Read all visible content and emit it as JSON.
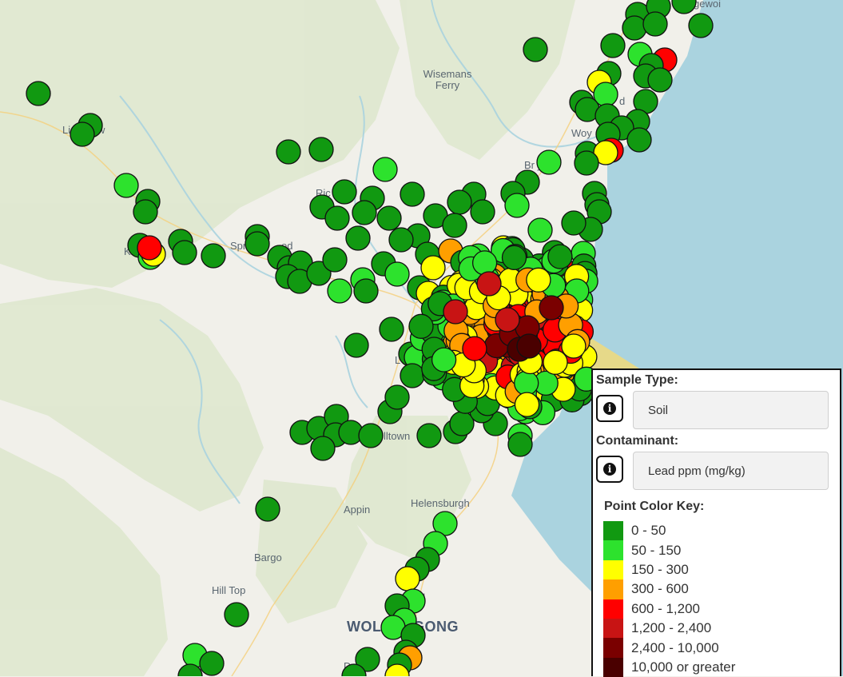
{
  "map": {
    "places": [
      {
        "name": "Wisemans"
      },
      {
        "name": "Ferry"
      },
      {
        "name": "Li"
      },
      {
        "name": "w"
      },
      {
        "name": "Ric"
      },
      {
        "name": "Spr"
      },
      {
        "name": "od"
      },
      {
        "name": "K"
      },
      {
        "name": "Woy"
      },
      {
        "name": "Br"
      },
      {
        "name": "yn"
      },
      {
        "name": "d"
      },
      {
        "name": "gewoi"
      },
      {
        "name": "lltown"
      },
      {
        "name": "Appin"
      },
      {
        "name": "Helensburgh"
      },
      {
        "name": "Bargo"
      },
      {
        "name": "Hill Top"
      },
      {
        "name": "WOLLONGONG"
      },
      {
        "name": "B"
      },
      {
        "name": "C"
      },
      {
        "name": "ol"
      },
      {
        "name": "L"
      },
      {
        "name": "D"
      }
    ],
    "point_colors": {
      "c1": "#119911",
      "c2": "#2de22d",
      "c3": "#ffff00",
      "c4": "#ff9f00",
      "c5": "#ff0000",
      "c6": "#c81414",
      "c7": "#7a0000",
      "c8": "#4a0000"
    }
  },
  "panel": {
    "sample_type_label": "Sample Type:",
    "sample_type_value": "Soil",
    "contaminant_label": "Contaminant:",
    "contaminant_value": "Lead ppm (mg/kg)",
    "info_icon": "info-icon",
    "key_title": "Point Color Key:",
    "key": [
      {
        "label": "0 - 50",
        "color": "#119911"
      },
      {
        "label": "50 - 150",
        "color": "#2de22d"
      },
      {
        "label": "150 - 300",
        "color": "#ffff00"
      },
      {
        "label": "300 - 600",
        "color": "#ff9f00"
      },
      {
        "label": "600 - 1,200",
        "color": "#ff0000"
      },
      {
        "label": "1,200 - 2,400",
        "color": "#c81414"
      },
      {
        "label": "2,400 - 10,000",
        "color": "#7a0000"
      },
      {
        "label": "10,000 or greater",
        "color": "#4a0000"
      }
    ]
  }
}
